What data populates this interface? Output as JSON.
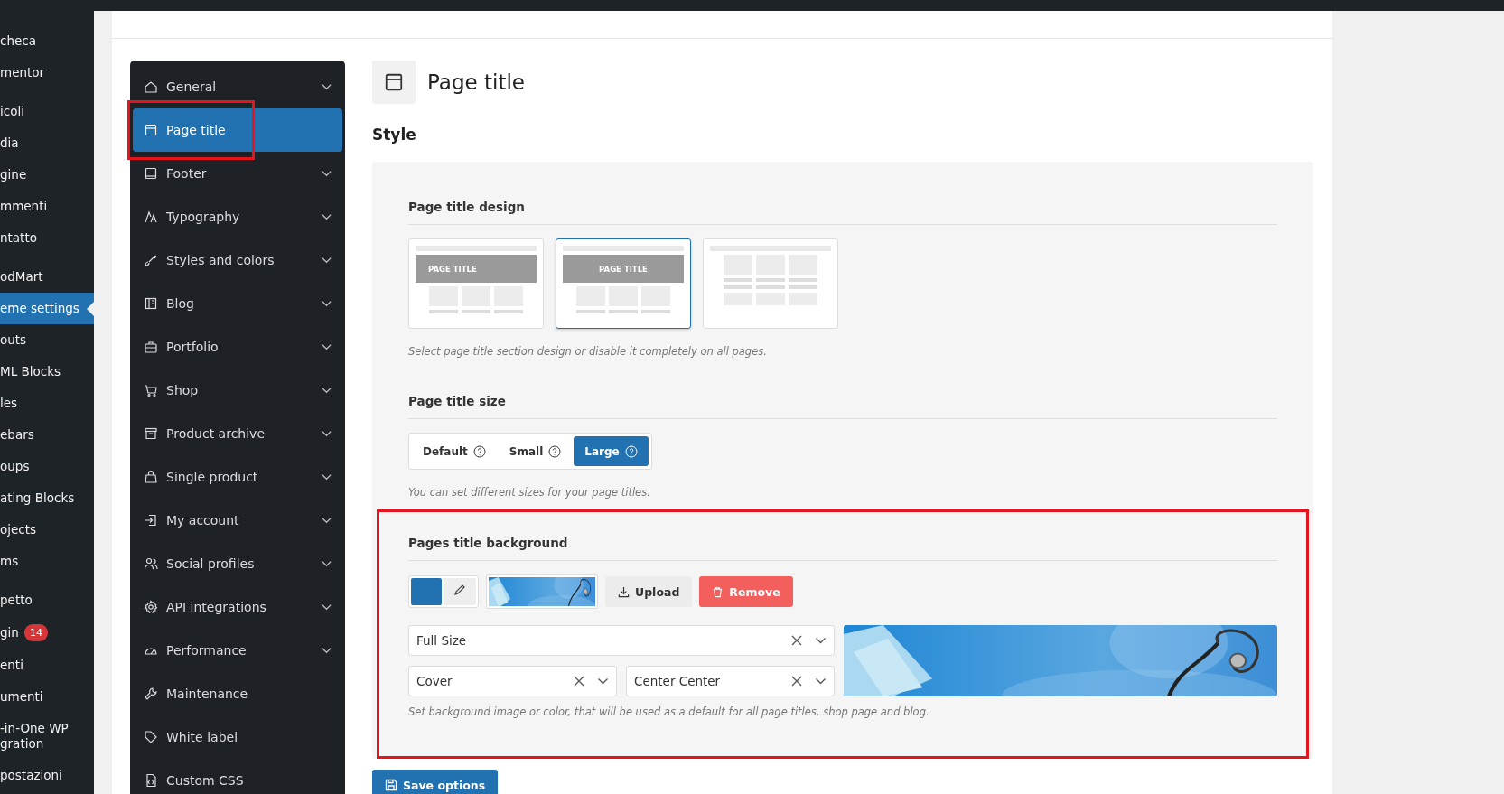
{
  "admin_menu": {
    "groups": [
      {
        "items": [
          {
            "label": "checa",
            "selected": false
          },
          {
            "label": "mentor",
            "selected": false
          }
        ]
      },
      {
        "items": [
          {
            "label": "icoli",
            "selected": false
          },
          {
            "label": "dia",
            "selected": false
          },
          {
            "label": "gine",
            "selected": false
          },
          {
            "label": "mmenti",
            "selected": false
          },
          {
            "label": "ntatto",
            "selected": false
          }
        ]
      },
      {
        "items": [
          {
            "label": "odMart",
            "selected": false
          },
          {
            "label": "eme settings",
            "selected": true
          },
          {
            "label": "outs",
            "selected": false
          },
          {
            "label": "ML Blocks",
            "selected": false
          },
          {
            "label": "les",
            "selected": false
          },
          {
            "label": "ebars",
            "selected": false
          },
          {
            "label": "oups",
            "selected": false
          },
          {
            "label": "ating Blocks",
            "selected": false
          },
          {
            "label": "ojects",
            "selected": false
          },
          {
            "label": "ms",
            "selected": false
          }
        ]
      },
      {
        "items": [
          {
            "label": "petto",
            "selected": false
          },
          {
            "label": "gin",
            "selected": false,
            "badge": "14"
          },
          {
            "label": "enti",
            "selected": false
          },
          {
            "label": "umenti",
            "selected": false
          },
          {
            "label": "-in-One WP\ngration",
            "selected": false
          },
          {
            "label": "postazioni",
            "selected": false
          }
        ]
      }
    ]
  },
  "settings_nav": {
    "items": [
      {
        "label": "General",
        "kind": "home",
        "expandable": true,
        "selected": false,
        "highlighted": false
      },
      {
        "label": "Page title",
        "kind": "page",
        "expandable": false,
        "selected": true,
        "highlighted": true
      },
      {
        "label": "Footer",
        "kind": "footer",
        "expandable": true,
        "selected": false,
        "highlighted": false
      },
      {
        "label": "Typography",
        "kind": "type",
        "expandable": true,
        "selected": false,
        "highlighted": false
      },
      {
        "label": "Styles and colors",
        "kind": "brush",
        "expandable": true,
        "selected": false,
        "highlighted": false
      },
      {
        "label": "Blog",
        "kind": "blog",
        "expandable": true,
        "selected": false,
        "highlighted": false
      },
      {
        "label": "Portfolio",
        "kind": "briefcase",
        "expandable": true,
        "selected": false,
        "highlighted": false
      },
      {
        "label": "Shop",
        "kind": "cart",
        "expandable": true,
        "selected": false,
        "highlighted": false
      },
      {
        "label": "Product archive",
        "kind": "archive",
        "expandable": true,
        "selected": false,
        "highlighted": false
      },
      {
        "label": "Single product",
        "kind": "bag",
        "expandable": true,
        "selected": false,
        "highlighted": false
      },
      {
        "label": "My account",
        "kind": "login",
        "expandable": true,
        "selected": false,
        "highlighted": false
      },
      {
        "label": "Social profiles",
        "kind": "users",
        "expandable": true,
        "selected": false,
        "highlighted": false
      },
      {
        "label": "API integrations",
        "kind": "gear",
        "expandable": true,
        "selected": false,
        "highlighted": false
      },
      {
        "label": "Performance",
        "kind": "gauge",
        "expandable": true,
        "selected": false,
        "highlighted": false
      },
      {
        "label": "Maintenance",
        "kind": "wrench",
        "expandable": false,
        "selected": false,
        "highlighted": false
      },
      {
        "label": "White label",
        "kind": "tag",
        "expandable": false,
        "selected": false,
        "highlighted": false
      },
      {
        "label": "Custom CSS",
        "kind": "file",
        "expandable": false,
        "selected": false,
        "highlighted": false
      }
    ]
  },
  "content": {
    "title": "Page title",
    "section": "Style",
    "design": {
      "label": "Page title design",
      "options": [
        {
          "kind": "left",
          "caption": "PAGE TITLE",
          "selected": false
        },
        {
          "kind": "centered",
          "caption": "PAGE TITLE",
          "selected": true
        },
        {
          "kind": "disabled",
          "selected": false
        }
      ],
      "description": "Select page title section design or disable it completely on all pages."
    },
    "size": {
      "label": "Page title size",
      "options": [
        {
          "label": "Default",
          "selected": false
        },
        {
          "label": "Small",
          "selected": false
        },
        {
          "label": "Large",
          "selected": true
        }
      ],
      "description": "You can set different sizes for your page titles."
    },
    "background": {
      "label": "Pages title background",
      "highlighted": true,
      "color": "#2271b1",
      "upload": "Upload",
      "remove": "Remove",
      "image_size": "Full Size",
      "fit": "Cover",
      "position": "Center Center",
      "description": "Set background image or color, that will be used as a default for all page titles, shop page and blog."
    },
    "save": "Save options"
  }
}
